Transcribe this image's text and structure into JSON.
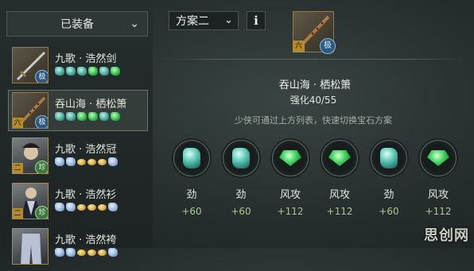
{
  "left_panel": {
    "dropdown_label": "已装备",
    "items": [
      {
        "name": "九歌 · 浩然剑",
        "tier": "",
        "badge": "极",
        "gems": [
          "teal",
          "teal",
          "teal",
          "green",
          "teal",
          "green"
        ]
      },
      {
        "name": "吞山海 · 栖松箫",
        "tier": "六",
        "badge": "极",
        "gems": [
          "teal",
          "teal",
          "green",
          "green",
          "teal",
          "green"
        ]
      },
      {
        "name": "九歌 · 浩然冠",
        "tier": "二",
        "badge": "珍",
        "gems": [
          "blue",
          "blue",
          "gold",
          "gold",
          "gold",
          "blue"
        ]
      },
      {
        "name": "九歌 · 浩然衫",
        "tier": "二",
        "badge": "珍",
        "gems": [
          "blue",
          "blue",
          "gold",
          "gold",
          "gold",
          "blue"
        ]
      },
      {
        "name": "九歌 · 浩然袴",
        "tier": "",
        "badge": "",
        "gems": [
          "blue",
          "blue",
          "gold",
          "gold",
          "gold",
          "blue"
        ]
      }
    ]
  },
  "toolbar": {
    "scheme_value": "方案二",
    "info_label": "i"
  },
  "detail": {
    "tier": "六",
    "badge": "极",
    "title": "吞山海 · 栖松箫",
    "strength": "强化40/55",
    "hint": "少侠可通过上方列表，快速切换宝石方案"
  },
  "slots": [
    {
      "gem": "teal",
      "stat": "劲",
      "value": "+60"
    },
    {
      "gem": "teal",
      "stat": "劲",
      "value": "+60"
    },
    {
      "gem": "green",
      "stat": "风攻",
      "value": "+112"
    },
    {
      "gem": "green",
      "stat": "风攻",
      "value": "+112"
    },
    {
      "gem": "teal",
      "stat": "劲",
      "value": "+60"
    },
    {
      "gem": "green",
      "stat": "风攻",
      "value": "+112"
    }
  ],
  "watermark": "思创网"
}
